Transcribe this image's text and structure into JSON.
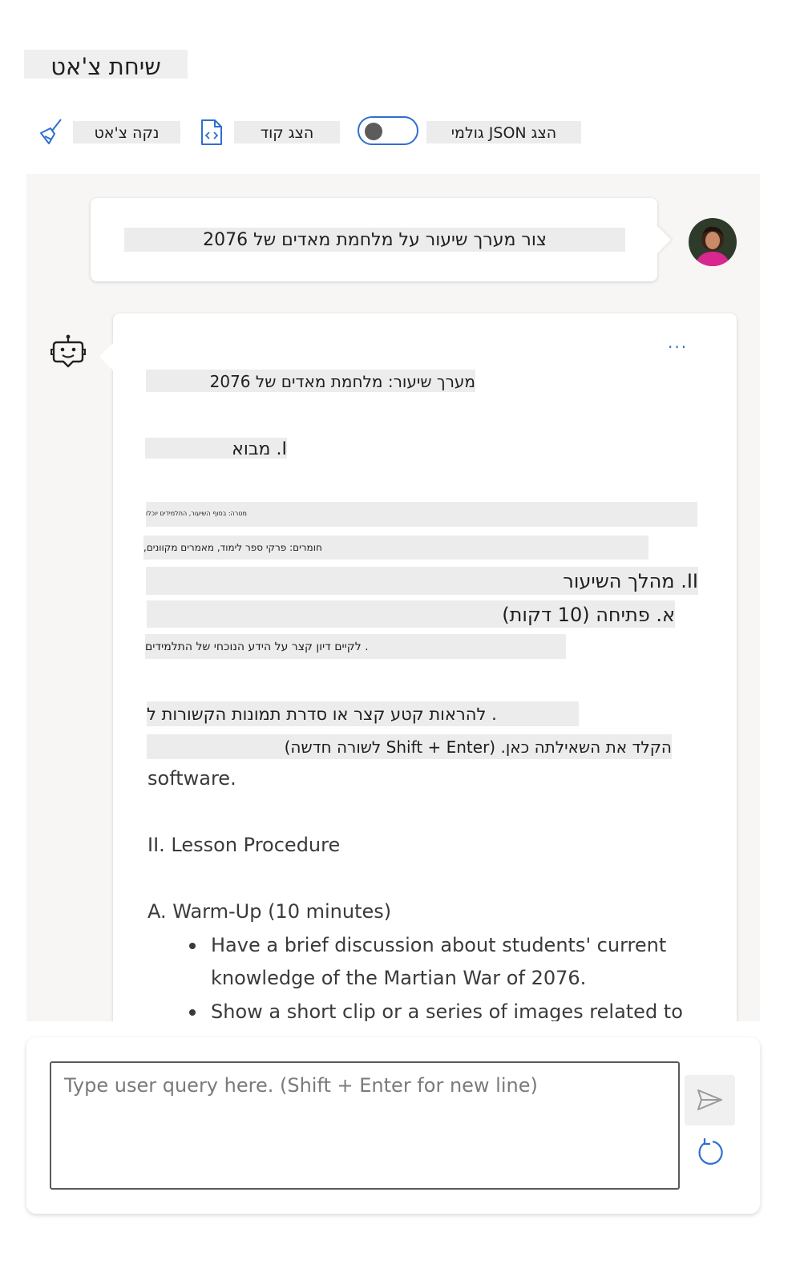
{
  "header": {
    "title": "שיחת צ'אט"
  },
  "toolbar": {
    "clear_chat_label": "נקה צ'אט",
    "show_code_label": "הצג קוד",
    "raw_json_label": "הצג JSON גולמי"
  },
  "conversation": {
    "user_message": "צור מערך שיעור על מלחמת מאדים של 2076",
    "assistant": {
      "more_label": "···",
      "lines": {
        "plan_title": "מערך שיעור: מלחמת מאדים של 2076",
        "intro_heading": "I. מבוא",
        "goal_line": "מטרה: בסוף השיעור, התלמידים יוכלו",
        "materials_line": "חומרים: פרקי ספר לימוד, מאמרים מקוונים,",
        "procedure_heading": "II. מהלך השיעור",
        "warmup_heading": "א. פתיחה (10 דקות)",
        "discuss_line": ". לקיים דיון קצר על הידע הנוכחי של התלמידים",
        "show_clip_line": ". להראות קטע קצר או סדרת תמונות הקשורות ל",
        "placeholder_overlay": "הקלד את השאילתה כאן. (Shift + Enter לשורה חדשה)",
        "software": "software.",
        "procedure_en": "II. Lesson Procedure",
        "warmup_en": "A. Warm-Up (10 minutes)",
        "bullet_1": "Have a brief discussion about students' current knowledge of the Martian War of 2076.",
        "bullet_2": "Show a short clip or a series of images related to"
      }
    }
  },
  "input": {
    "placeholder": "Type user query here. (Shift + Enter for new line)"
  },
  "icons": {
    "clear": "broom-icon",
    "code": "code-file-icon",
    "bot": "bot-icon",
    "send": "send-icon",
    "refresh": "refresh-icon",
    "avatar": "user-avatar"
  },
  "colors": {
    "accent": "#2f6fd1",
    "panel": "#f7f6f5"
  }
}
